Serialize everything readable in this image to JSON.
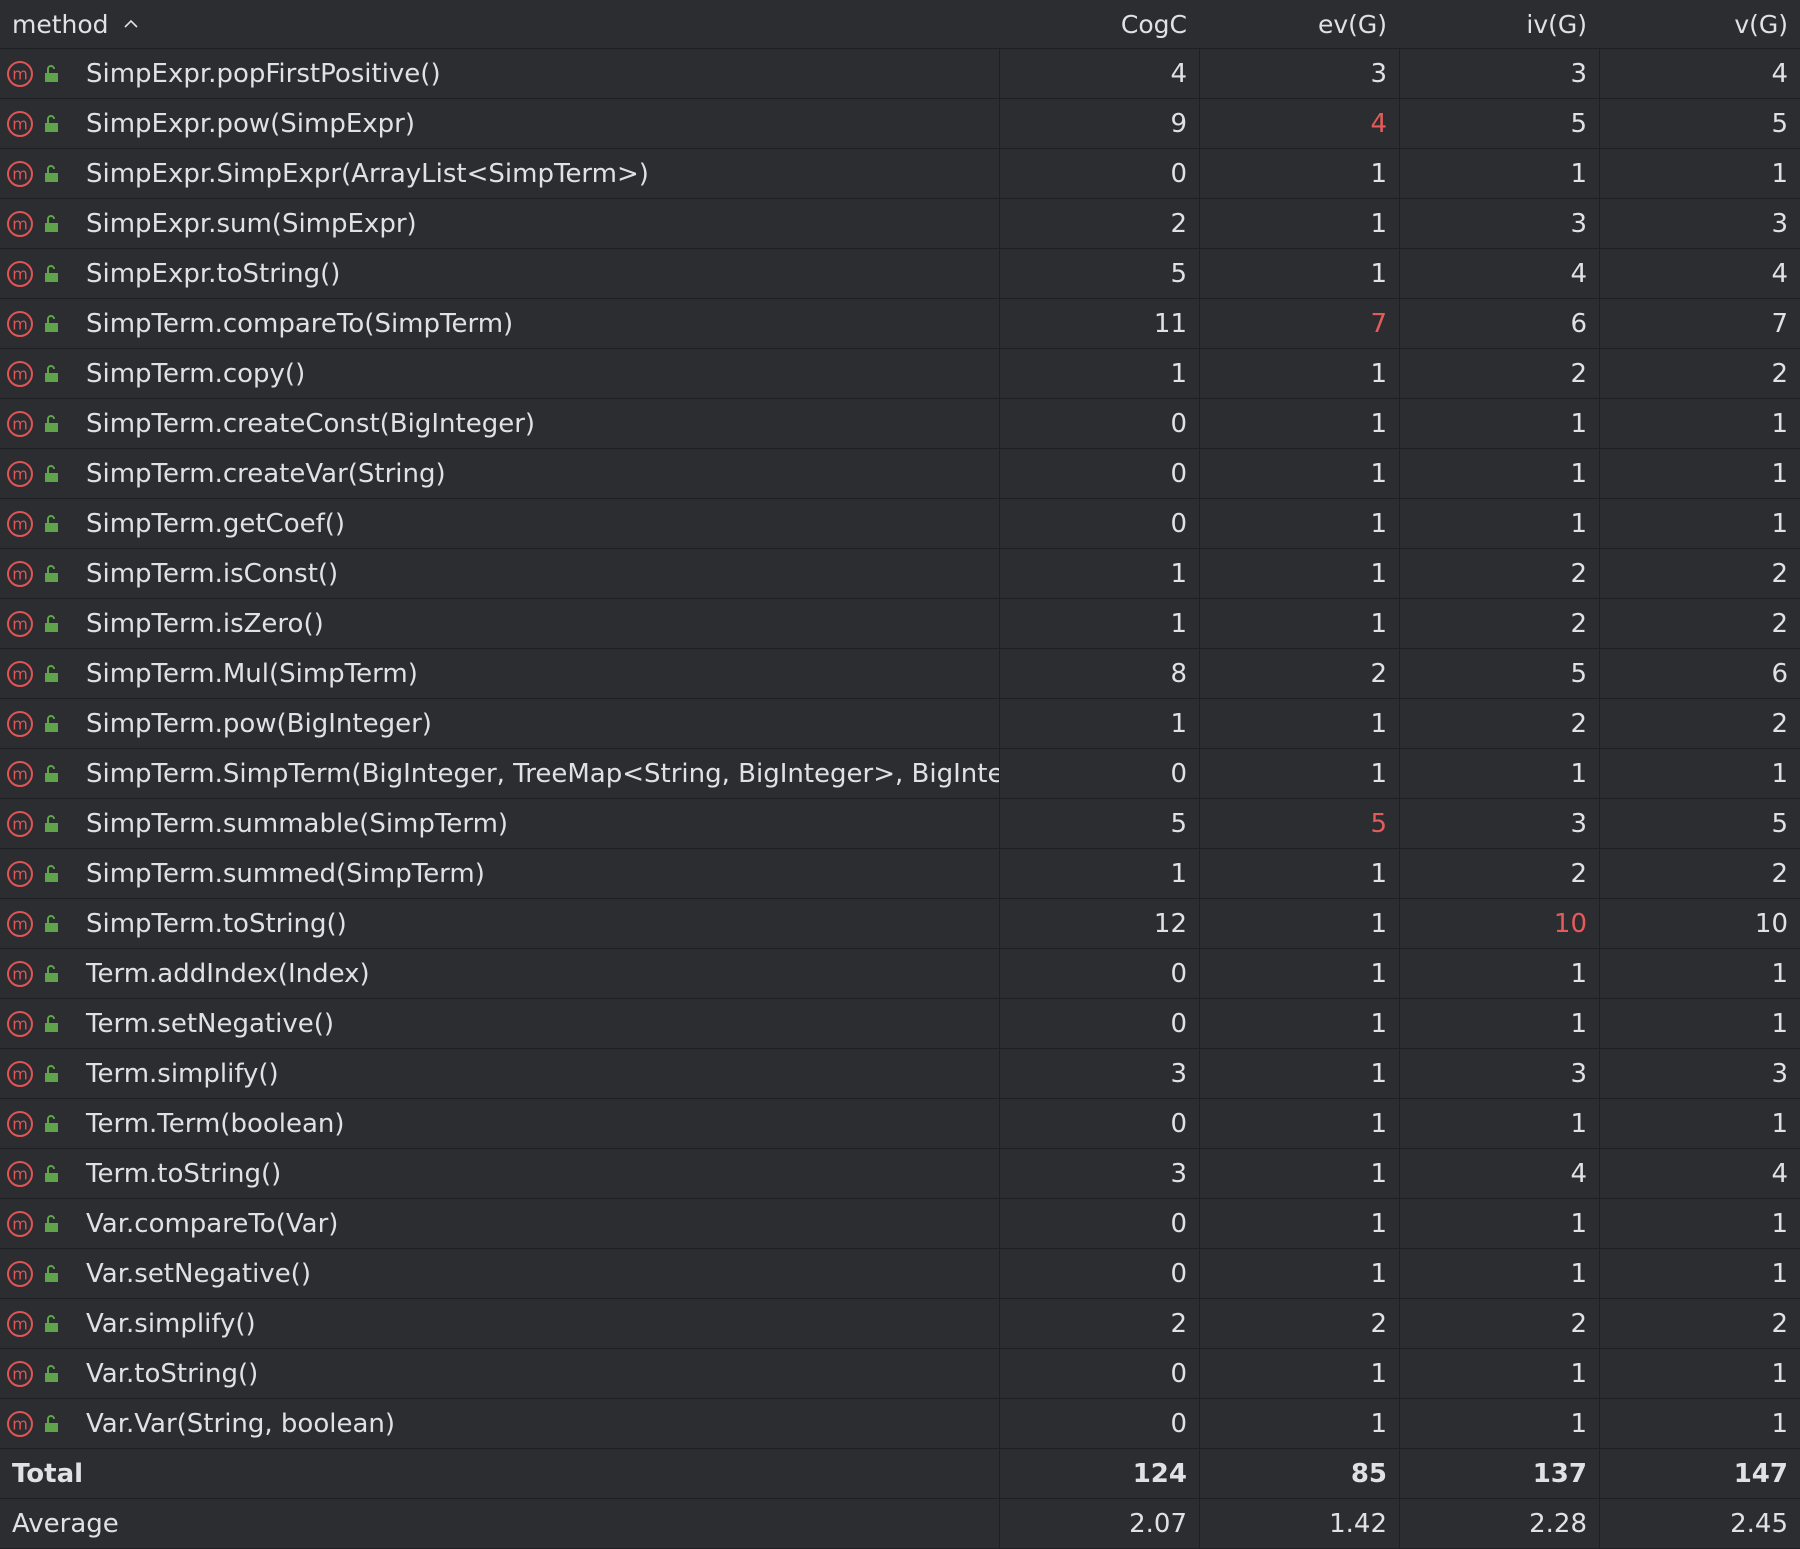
{
  "columns": {
    "method": "method",
    "cogc": "CogC",
    "ev": "ev(G)",
    "iv": "iv(G)",
    "v": "v(G)"
  },
  "colors": {
    "background": "#2b2d30",
    "text": "#dfe1e5",
    "highlight": "#e55b5b",
    "method_icon": "#e05555",
    "lock_icon": "#5fa34a"
  },
  "icons": {
    "method": "method-m-icon",
    "visibility": "public-lock-icon",
    "sort": "sort-ascending-icon"
  },
  "rows": [
    {
      "method": "SimpExpr.popFirstPositive()",
      "cogc": "4",
      "ev": "3",
      "iv": "3",
      "v": "4",
      "hl": []
    },
    {
      "method": "SimpExpr.pow(SimpExpr)",
      "cogc": "9",
      "ev": "4",
      "iv": "5",
      "v": "5",
      "hl": [
        "ev"
      ]
    },
    {
      "method": "SimpExpr.SimpExpr(ArrayList<SimpTerm>)",
      "cogc": "0",
      "ev": "1",
      "iv": "1",
      "v": "1",
      "hl": []
    },
    {
      "method": "SimpExpr.sum(SimpExpr)",
      "cogc": "2",
      "ev": "1",
      "iv": "3",
      "v": "3",
      "hl": []
    },
    {
      "method": "SimpExpr.toString()",
      "cogc": "5",
      "ev": "1",
      "iv": "4",
      "v": "4",
      "hl": []
    },
    {
      "method": "SimpTerm.compareTo(SimpTerm)",
      "cogc": "11",
      "ev": "7",
      "iv": "6",
      "v": "7",
      "hl": [
        "ev"
      ]
    },
    {
      "method": "SimpTerm.copy()",
      "cogc": "1",
      "ev": "1",
      "iv": "2",
      "v": "2",
      "hl": []
    },
    {
      "method": "SimpTerm.createConst(BigInteger)",
      "cogc": "0",
      "ev": "1",
      "iv": "1",
      "v": "1",
      "hl": []
    },
    {
      "method": "SimpTerm.createVar(String)",
      "cogc": "0",
      "ev": "1",
      "iv": "1",
      "v": "1",
      "hl": []
    },
    {
      "method": "SimpTerm.getCoef()",
      "cogc": "0",
      "ev": "1",
      "iv": "1",
      "v": "1",
      "hl": []
    },
    {
      "method": "SimpTerm.isConst()",
      "cogc": "1",
      "ev": "1",
      "iv": "2",
      "v": "2",
      "hl": []
    },
    {
      "method": "SimpTerm.isZero()",
      "cogc": "1",
      "ev": "1",
      "iv": "2",
      "v": "2",
      "hl": []
    },
    {
      "method": "SimpTerm.Mul(SimpTerm)",
      "cogc": "8",
      "ev": "2",
      "iv": "5",
      "v": "6",
      "hl": []
    },
    {
      "method": "SimpTerm.pow(BigInteger)",
      "cogc": "1",
      "ev": "1",
      "iv": "2",
      "v": "2",
      "hl": []
    },
    {
      "method": "SimpTerm.SimpTerm(BigInteger, TreeMap<String, BigInteger>, BigInteger)",
      "cogc": "0",
      "ev": "1",
      "iv": "1",
      "v": "1",
      "hl": []
    },
    {
      "method": "SimpTerm.summable(SimpTerm)",
      "cogc": "5",
      "ev": "5",
      "iv": "3",
      "v": "5",
      "hl": [
        "ev"
      ]
    },
    {
      "method": "SimpTerm.summed(SimpTerm)",
      "cogc": "1",
      "ev": "1",
      "iv": "2",
      "v": "2",
      "hl": []
    },
    {
      "method": "SimpTerm.toString()",
      "cogc": "12",
      "ev": "1",
      "iv": "10",
      "v": "10",
      "hl": [
        "iv"
      ]
    },
    {
      "method": "Term.addIndex(Index)",
      "cogc": "0",
      "ev": "1",
      "iv": "1",
      "v": "1",
      "hl": []
    },
    {
      "method": "Term.setNegative()",
      "cogc": "0",
      "ev": "1",
      "iv": "1",
      "v": "1",
      "hl": []
    },
    {
      "method": "Term.simplify()",
      "cogc": "3",
      "ev": "1",
      "iv": "3",
      "v": "3",
      "hl": []
    },
    {
      "method": "Term.Term(boolean)",
      "cogc": "0",
      "ev": "1",
      "iv": "1",
      "v": "1",
      "hl": []
    },
    {
      "method": "Term.toString()",
      "cogc": "3",
      "ev": "1",
      "iv": "4",
      "v": "4",
      "hl": []
    },
    {
      "method": "Var.compareTo(Var)",
      "cogc": "0",
      "ev": "1",
      "iv": "1",
      "v": "1",
      "hl": []
    },
    {
      "method": "Var.setNegative()",
      "cogc": "0",
      "ev": "1",
      "iv": "1",
      "v": "1",
      "hl": []
    },
    {
      "method": "Var.simplify()",
      "cogc": "2",
      "ev": "2",
      "iv": "2",
      "v": "2",
      "hl": []
    },
    {
      "method": "Var.toString()",
      "cogc": "0",
      "ev": "1",
      "iv": "1",
      "v": "1",
      "hl": []
    },
    {
      "method": "Var.Var(String, boolean)",
      "cogc": "0",
      "ev": "1",
      "iv": "1",
      "v": "1",
      "hl": []
    }
  ],
  "total": {
    "label": "Total",
    "cogc": "124",
    "ev": "85",
    "iv": "137",
    "v": "147"
  },
  "average": {
    "label": "Average",
    "cogc": "2.07",
    "ev": "1.42",
    "iv": "2.28",
    "v": "2.45"
  }
}
